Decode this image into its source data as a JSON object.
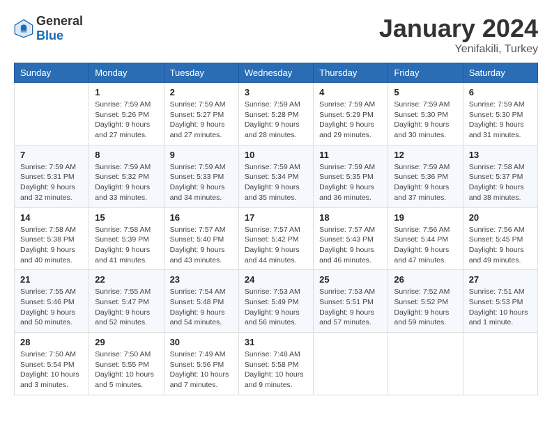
{
  "logo": {
    "text_general": "General",
    "text_blue": "Blue"
  },
  "title": "January 2024",
  "subtitle": "Yenifakili, Turkey",
  "header_days": [
    "Sunday",
    "Monday",
    "Tuesday",
    "Wednesday",
    "Thursday",
    "Friday",
    "Saturday"
  ],
  "weeks": [
    [
      {
        "day": "",
        "info": ""
      },
      {
        "day": "1",
        "info": "Sunrise: 7:59 AM\nSunset: 5:26 PM\nDaylight: 9 hours\nand 27 minutes."
      },
      {
        "day": "2",
        "info": "Sunrise: 7:59 AM\nSunset: 5:27 PM\nDaylight: 9 hours\nand 27 minutes."
      },
      {
        "day": "3",
        "info": "Sunrise: 7:59 AM\nSunset: 5:28 PM\nDaylight: 9 hours\nand 28 minutes."
      },
      {
        "day": "4",
        "info": "Sunrise: 7:59 AM\nSunset: 5:29 PM\nDaylight: 9 hours\nand 29 minutes."
      },
      {
        "day": "5",
        "info": "Sunrise: 7:59 AM\nSunset: 5:30 PM\nDaylight: 9 hours\nand 30 minutes."
      },
      {
        "day": "6",
        "info": "Sunrise: 7:59 AM\nSunset: 5:30 PM\nDaylight: 9 hours\nand 31 minutes."
      }
    ],
    [
      {
        "day": "7",
        "info": "Sunrise: 7:59 AM\nSunset: 5:31 PM\nDaylight: 9 hours\nand 32 minutes."
      },
      {
        "day": "8",
        "info": "Sunrise: 7:59 AM\nSunset: 5:32 PM\nDaylight: 9 hours\nand 33 minutes."
      },
      {
        "day": "9",
        "info": "Sunrise: 7:59 AM\nSunset: 5:33 PM\nDaylight: 9 hours\nand 34 minutes."
      },
      {
        "day": "10",
        "info": "Sunrise: 7:59 AM\nSunset: 5:34 PM\nDaylight: 9 hours\nand 35 minutes."
      },
      {
        "day": "11",
        "info": "Sunrise: 7:59 AM\nSunset: 5:35 PM\nDaylight: 9 hours\nand 36 minutes."
      },
      {
        "day": "12",
        "info": "Sunrise: 7:59 AM\nSunset: 5:36 PM\nDaylight: 9 hours\nand 37 minutes."
      },
      {
        "day": "13",
        "info": "Sunrise: 7:58 AM\nSunset: 5:37 PM\nDaylight: 9 hours\nand 38 minutes."
      }
    ],
    [
      {
        "day": "14",
        "info": "Sunrise: 7:58 AM\nSunset: 5:38 PM\nDaylight: 9 hours\nand 40 minutes."
      },
      {
        "day": "15",
        "info": "Sunrise: 7:58 AM\nSunset: 5:39 PM\nDaylight: 9 hours\nand 41 minutes."
      },
      {
        "day": "16",
        "info": "Sunrise: 7:57 AM\nSunset: 5:40 PM\nDaylight: 9 hours\nand 43 minutes."
      },
      {
        "day": "17",
        "info": "Sunrise: 7:57 AM\nSunset: 5:42 PM\nDaylight: 9 hours\nand 44 minutes."
      },
      {
        "day": "18",
        "info": "Sunrise: 7:57 AM\nSunset: 5:43 PM\nDaylight: 9 hours\nand 46 minutes."
      },
      {
        "day": "19",
        "info": "Sunrise: 7:56 AM\nSunset: 5:44 PM\nDaylight: 9 hours\nand 47 minutes."
      },
      {
        "day": "20",
        "info": "Sunrise: 7:56 AM\nSunset: 5:45 PM\nDaylight: 9 hours\nand 49 minutes."
      }
    ],
    [
      {
        "day": "21",
        "info": "Sunrise: 7:55 AM\nSunset: 5:46 PM\nDaylight: 9 hours\nand 50 minutes."
      },
      {
        "day": "22",
        "info": "Sunrise: 7:55 AM\nSunset: 5:47 PM\nDaylight: 9 hours\nand 52 minutes."
      },
      {
        "day": "23",
        "info": "Sunrise: 7:54 AM\nSunset: 5:48 PM\nDaylight: 9 hours\nand 54 minutes."
      },
      {
        "day": "24",
        "info": "Sunrise: 7:53 AM\nSunset: 5:49 PM\nDaylight: 9 hours\nand 56 minutes."
      },
      {
        "day": "25",
        "info": "Sunrise: 7:53 AM\nSunset: 5:51 PM\nDaylight: 9 hours\nand 57 minutes."
      },
      {
        "day": "26",
        "info": "Sunrise: 7:52 AM\nSunset: 5:52 PM\nDaylight: 9 hours\nand 59 minutes."
      },
      {
        "day": "27",
        "info": "Sunrise: 7:51 AM\nSunset: 5:53 PM\nDaylight: 10 hours\nand 1 minute."
      }
    ],
    [
      {
        "day": "28",
        "info": "Sunrise: 7:50 AM\nSunset: 5:54 PM\nDaylight: 10 hours\nand 3 minutes."
      },
      {
        "day": "29",
        "info": "Sunrise: 7:50 AM\nSunset: 5:55 PM\nDaylight: 10 hours\nand 5 minutes."
      },
      {
        "day": "30",
        "info": "Sunrise: 7:49 AM\nSunset: 5:56 PM\nDaylight: 10 hours\nand 7 minutes."
      },
      {
        "day": "31",
        "info": "Sunrise: 7:48 AM\nSunset: 5:58 PM\nDaylight: 10 hours\nand 9 minutes."
      },
      {
        "day": "",
        "info": ""
      },
      {
        "day": "",
        "info": ""
      },
      {
        "day": "",
        "info": ""
      }
    ]
  ]
}
